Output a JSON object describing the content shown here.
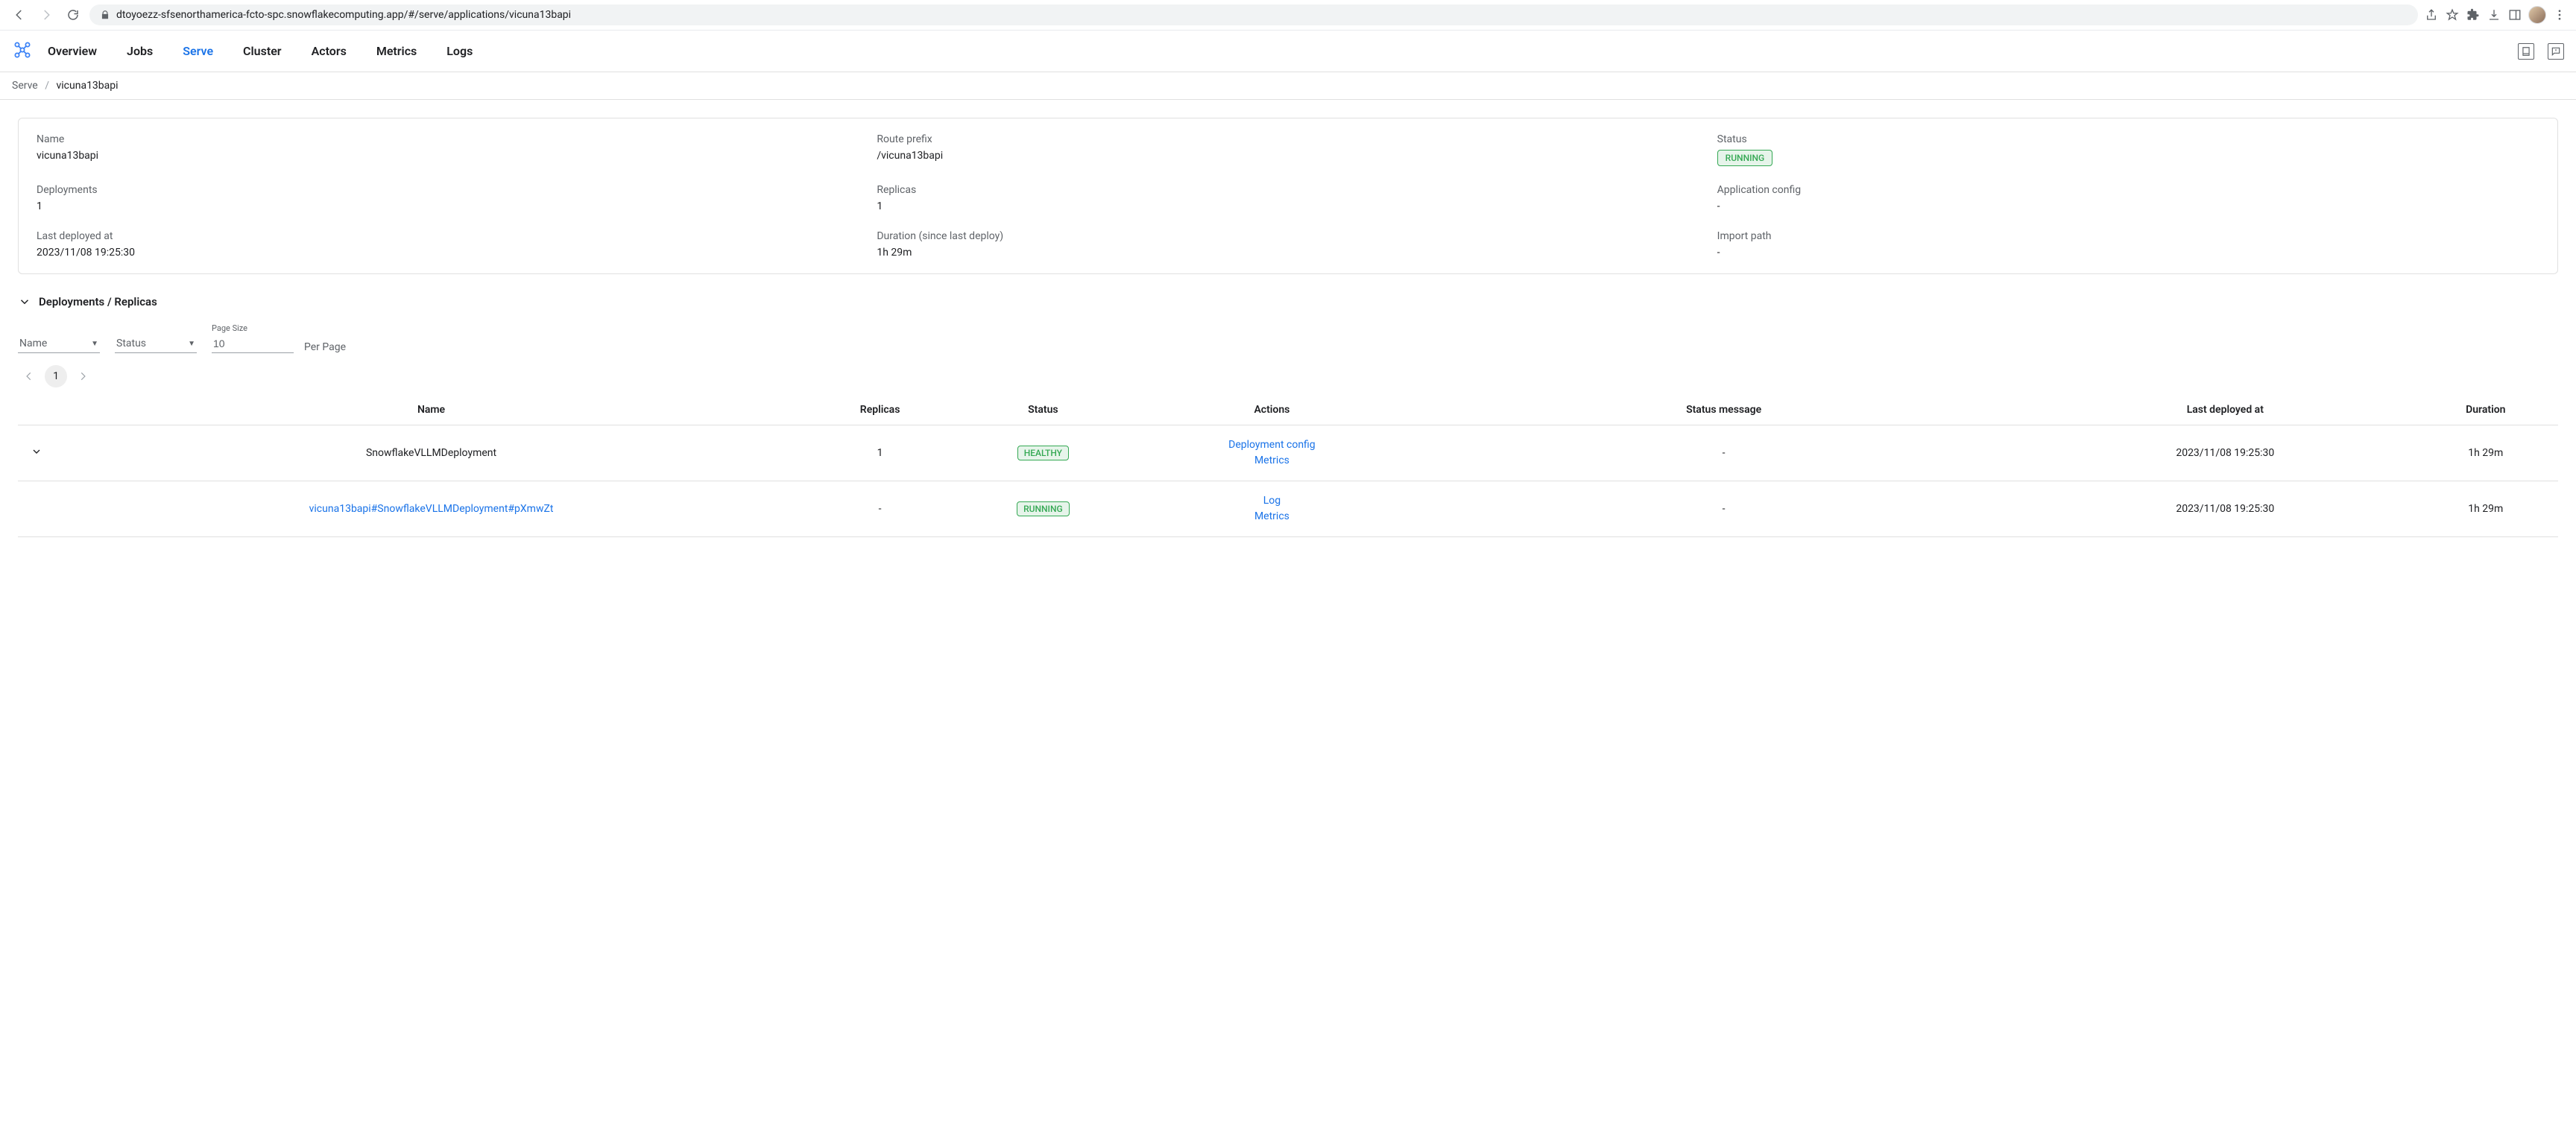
{
  "browser": {
    "url": "dtoyoezz-sfsenorthamerica-fcto-spc.snowflakecomputing.app/#/serve/applications/vicuna13bapi"
  },
  "nav": {
    "links": [
      "Overview",
      "Jobs",
      "Serve",
      "Cluster",
      "Actors",
      "Metrics",
      "Logs"
    ],
    "active": "Serve"
  },
  "breadcrumb": {
    "root": "Serve",
    "current": "vicuna13bapi"
  },
  "info": {
    "name_label": "Name",
    "name_value": "vicuna13bapi",
    "route_prefix_label": "Route prefix",
    "route_prefix_value": "/vicuna13bapi",
    "status_label": "Status",
    "status_value": "RUNNING",
    "deployments_label": "Deployments",
    "deployments_value": "1",
    "replicas_label": "Replicas",
    "replicas_value": "1",
    "app_config_label": "Application config",
    "app_config_value": "-",
    "last_deployed_label": "Last deployed at",
    "last_deployed_value": "2023/11/08 19:25:30",
    "duration_label": "Duration (since last deploy)",
    "duration_value": "1h 29m",
    "import_path_label": "Import path",
    "import_path_value": "-"
  },
  "section": {
    "title": "Deployments / Replicas"
  },
  "filters": {
    "name_label": "Name",
    "status_label": "Status",
    "page_size_label": "Page Size",
    "page_size_value": "10",
    "per_page": "Per Page"
  },
  "pagination": {
    "current": "1"
  },
  "table": {
    "headers": {
      "name": "Name",
      "replicas": "Replicas",
      "status": "Status",
      "actions": "Actions",
      "status_message": "Status message",
      "last_deployed": "Last deployed at",
      "duration": "Duration"
    },
    "rows": [
      {
        "expandable": true,
        "name": "SnowflakeVLLMDeployment",
        "name_is_link": false,
        "replicas": "1",
        "status": "HEALTHY",
        "actions": [
          "Deployment config",
          "Metrics"
        ],
        "status_message": "-",
        "last_deployed": "2023/11/08 19:25:30",
        "duration": "1h 29m"
      },
      {
        "expandable": false,
        "name": "vicuna13bapi#SnowflakeVLLMDeployment#pXmwZt",
        "name_is_link": true,
        "replicas": "-",
        "status": "RUNNING",
        "actions": [
          "Log",
          "Metrics"
        ],
        "status_message": "-",
        "last_deployed": "2023/11/08 19:25:30",
        "duration": "1h 29m"
      }
    ]
  }
}
